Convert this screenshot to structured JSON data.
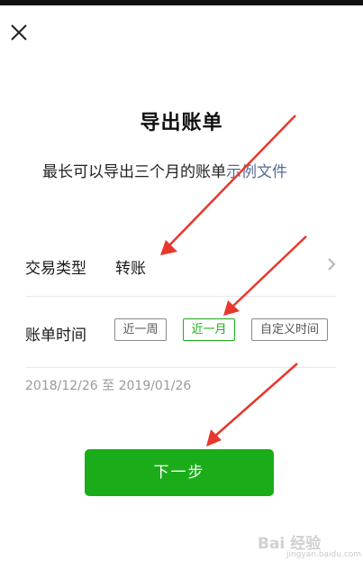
{
  "header": {
    "close_icon": "close-icon"
  },
  "main": {
    "title": "导出账单",
    "subtitle_text": "最长可以导出三个月的账单",
    "example_link": "示例文件"
  },
  "form": {
    "transaction_type": {
      "label": "交易类型",
      "value": "转账",
      "icon": "chevron-right-icon"
    },
    "bill_time": {
      "label": "账单时间",
      "options": [
        "近一周",
        "近一月",
        "自定义时间"
      ],
      "selected": "近一月"
    },
    "date_range": "2018/12/26 至 2019/01/26"
  },
  "actions": {
    "next_label": "下一步"
  },
  "colors": {
    "accent": "#1aad19",
    "link": "#576b95",
    "annotation_arrow": "#e8372c"
  },
  "watermark": {
    "main": "Bai 经验",
    "sub": "jingyan.baidu.com"
  }
}
